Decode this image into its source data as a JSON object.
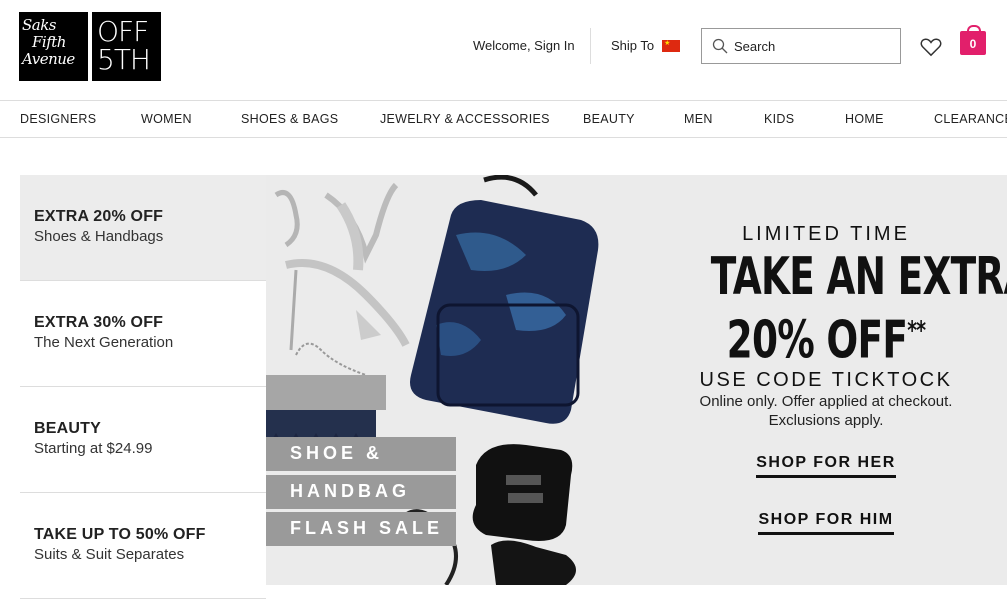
{
  "brand": {
    "saks_lines": [
      "Saks",
      "Fifth",
      "Avenue"
    ],
    "off5_lines": [
      "OFF",
      "5TH"
    ]
  },
  "header": {
    "welcome": "Welcome, Sign In",
    "ship_to": "Ship To",
    "search_placeholder": "Search",
    "bag_count": "0"
  },
  "nav": {
    "items": [
      "DESIGNERS",
      "WOMEN",
      "SHOES & BAGS",
      "JEWELRY & ACCESSORIES",
      "BEAUTY",
      "MEN",
      "KIDS",
      "HOME",
      "CLEARANCE"
    ]
  },
  "promos": [
    {
      "title": "EXTRA 20% OFF",
      "sub": "Shoes & Handbags"
    },
    {
      "title": "EXTRA 30% OFF",
      "sub": "The Next Generation"
    },
    {
      "title": "BEAUTY",
      "sub": "Starting at $24.99"
    },
    {
      "title": "TAKE UP TO 50% OFF",
      "sub": "Suits & Suit Separates"
    }
  ],
  "hero": {
    "flash": [
      "SHOE &",
      "HANDBAG",
      "FLASH SALE"
    ],
    "limited": "LIMITED TIME",
    "line1": "TAKE AN EXTRA",
    "line2": "20% OFF",
    "line2_sup": "**",
    "code": "USE CODE TICKTOCK",
    "fine1": "Online only. Offer applied at checkout.",
    "fine2": "Exclusions apply.",
    "cta_her": "SHOP FOR HER",
    "cta_him": "SHOP FOR HIM"
  },
  "colors": {
    "bag_accent": "#e21f6b",
    "hero_bg": "#ebebeb",
    "flash_bg": "#9a9a9a"
  }
}
